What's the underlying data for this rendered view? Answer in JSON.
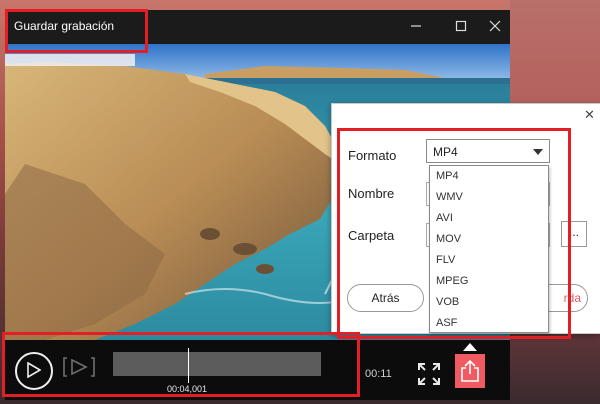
{
  "window": {
    "title": "Guardar grabación",
    "minimize_icon": "minimize-icon",
    "maximize_icon": "maximize-icon",
    "close_icon": "close-icon"
  },
  "player": {
    "current_time": "00:04,001",
    "duration_visible": "00:11",
    "progress": 0.365,
    "icons": [
      "play-icon",
      "frame-step-icon",
      "fullscreen-icon",
      "share-export-icon"
    ],
    "accent_color": "#ef5b60"
  },
  "save_dialog": {
    "close_glyph": "✕",
    "format_label": "Formato",
    "format_value": "MP4",
    "name_label": "Nombre",
    "folder_label": "Carpeta",
    "browse_label": "...",
    "back_label": "Atrás",
    "save_label_visible": "rda",
    "format_options": [
      "MP4",
      "WMV",
      "AVI",
      "MOV",
      "FLV",
      "MPEG",
      "VOB",
      "ASF"
    ]
  },
  "highlight_color": "#e31e24"
}
